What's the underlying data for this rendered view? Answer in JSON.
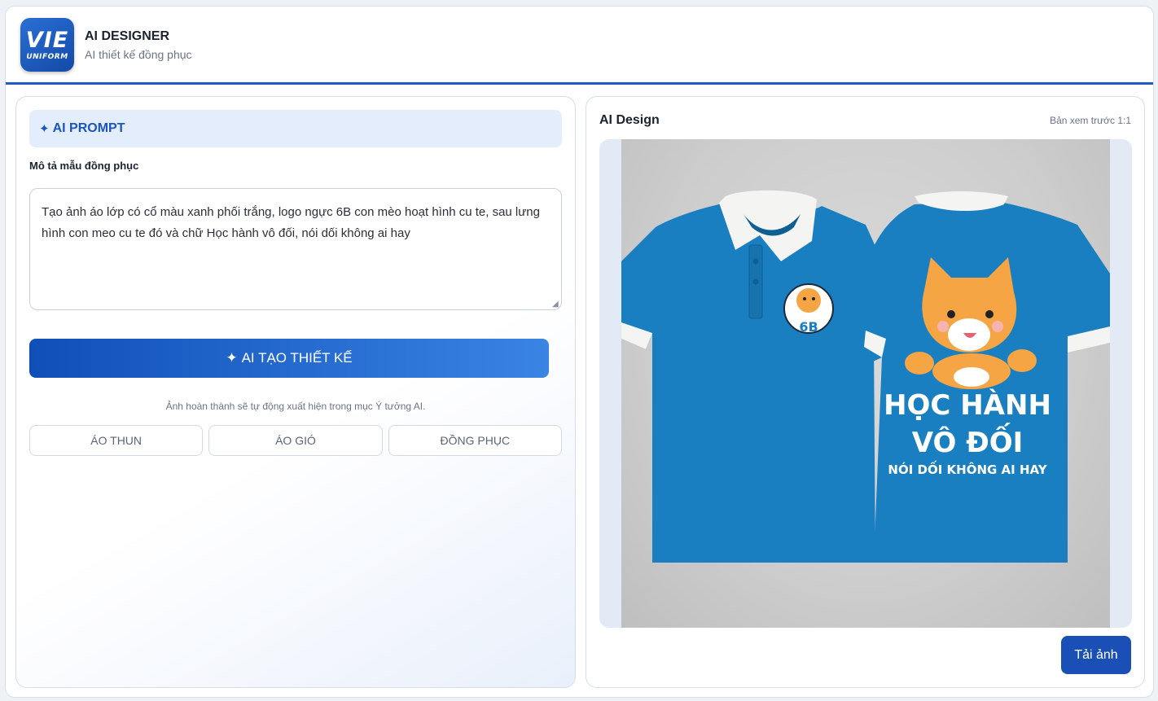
{
  "header": {
    "logo_text_top": "VIE",
    "logo_text_bottom": "UNIFORM",
    "title": "AI DESIGNER",
    "subtitle": "AI thiết kế đồng phục"
  },
  "left_panel": {
    "section_title": "AI PROMPT",
    "field_label": "Mô tả mẫu đồng phục",
    "prompt_value": "Tạo ảnh áo lớp có cổ màu xanh phối trắng, logo ngực 6B con mèo hoạt hình cu te, sau lưng hình con meo cu te đó và chữ Học hành vô đối, nói dối không ai hay",
    "generate_label": "AI TẠO THIẾT KẾ",
    "note": "Ảnh hoàn thành sẽ tự động xuất hiện trong mục Ý tưởng AI.",
    "chips": [
      "ÁO THUN",
      "ÁO GIÓ",
      "ĐỒNG PHỤC"
    ]
  },
  "right_panel": {
    "title": "AI Design",
    "preview_label": "Bản xem trước 1:1",
    "image": {
      "shirt_color": "#1a7fc0",
      "collar_color": "#f4f4f2",
      "logo_text": "6B",
      "back_line1": "HỌC HÀNH",
      "back_line2": "VÔ ĐỐI",
      "back_line3": "NÓI DỐI KHÔNG AI HAY"
    },
    "download_label": "Tải ảnh"
  },
  "colors": {
    "accent": "#1f5cc1",
    "button_dark": "#1a4fb5",
    "prompt_head_bg": "#e4edfc"
  }
}
